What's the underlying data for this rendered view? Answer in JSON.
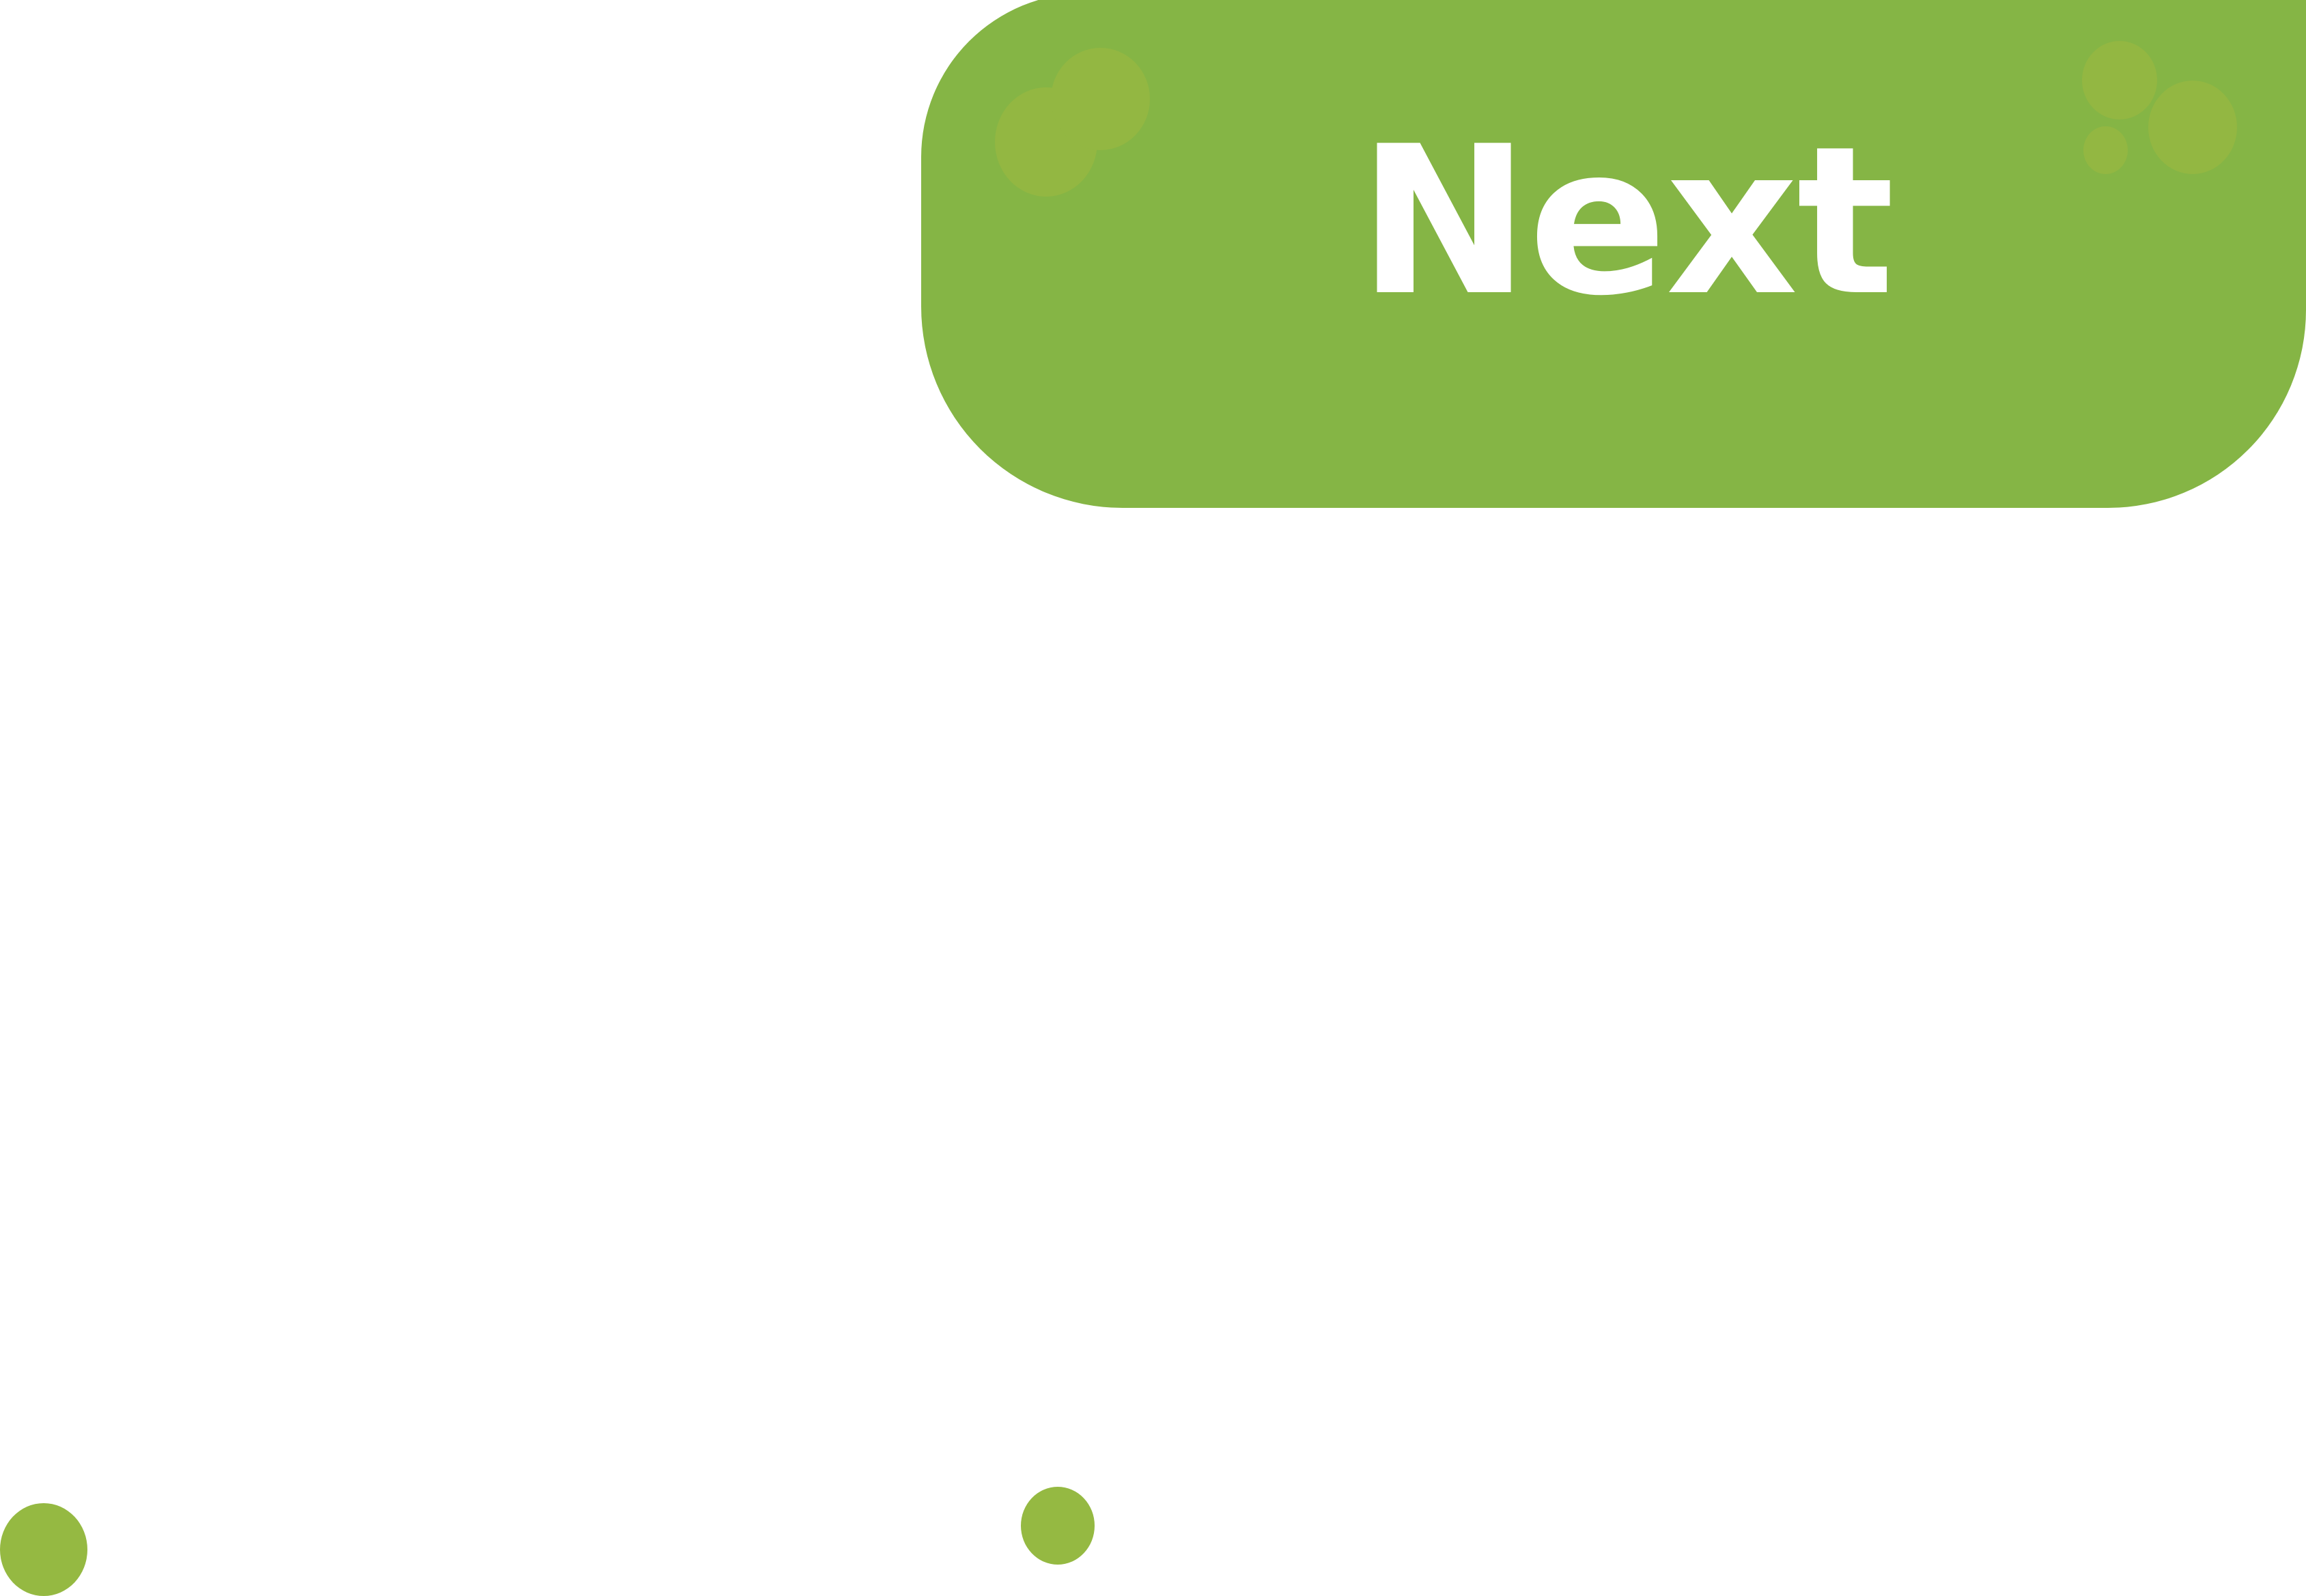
{
  "next_button": {
    "label": "Next",
    "background": "#85b545",
    "text_color": "#ffffff",
    "decoration_color": "#93b742"
  },
  "page": {
    "background": "#ffffff",
    "dot_color": "#95b942"
  }
}
